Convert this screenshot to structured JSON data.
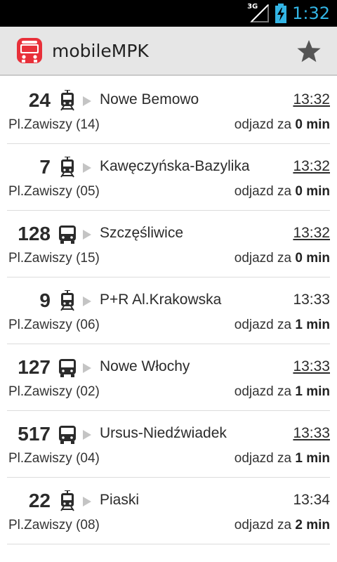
{
  "status_bar": {
    "network": "3G",
    "time": "1:32"
  },
  "app": {
    "title": "mobileMPK"
  },
  "departures": [
    {
      "line": "24",
      "vehicle": "tram",
      "destination": "Nowe Bemowo",
      "time": "13:32",
      "time_underlined": true,
      "stop": "Pl.Zawiszy (14)",
      "departs_prefix": "odjazd za",
      "departs_value": "0 min"
    },
    {
      "line": "7",
      "vehicle": "tram",
      "destination": "Kawęczyńska-Bazylika",
      "time": "13:32",
      "time_underlined": true,
      "stop": "Pl.Zawiszy (05)",
      "departs_prefix": "odjazd za",
      "departs_value": "0 min"
    },
    {
      "line": "128",
      "vehicle": "bus",
      "destination": "Szczęśliwice",
      "time": "13:32",
      "time_underlined": true,
      "stop": "Pl.Zawiszy (15)",
      "departs_prefix": "odjazd za",
      "departs_value": "0 min"
    },
    {
      "line": "9",
      "vehicle": "tram",
      "destination": "P+R Al.Krakowska",
      "time": "13:33",
      "time_underlined": false,
      "stop": "Pl.Zawiszy (06)",
      "departs_prefix": "odjazd za",
      "departs_value": "1 min"
    },
    {
      "line": "127",
      "vehicle": "bus",
      "destination": "Nowe Włochy",
      "time": "13:33",
      "time_underlined": true,
      "stop": "Pl.Zawiszy (02)",
      "departs_prefix": "odjazd za",
      "departs_value": "1 min"
    },
    {
      "line": "517",
      "vehicle": "bus",
      "destination": "Ursus-Niedźwiadek",
      "time": "13:33",
      "time_underlined": true,
      "stop": "Pl.Zawiszy (04)",
      "departs_prefix": "odjazd za",
      "departs_value": "1 min"
    },
    {
      "line": "22",
      "vehicle": "tram",
      "destination": "Piaski",
      "time": "13:34",
      "time_underlined": false,
      "stop": "Pl.Zawiszy (08)",
      "departs_prefix": "odjazd za",
      "departs_value": "2 min"
    }
  ],
  "colors": {
    "accent": "#33b5e5",
    "app_icon_red": "#e8303a",
    "actionbar": "#e6e6e6"
  }
}
